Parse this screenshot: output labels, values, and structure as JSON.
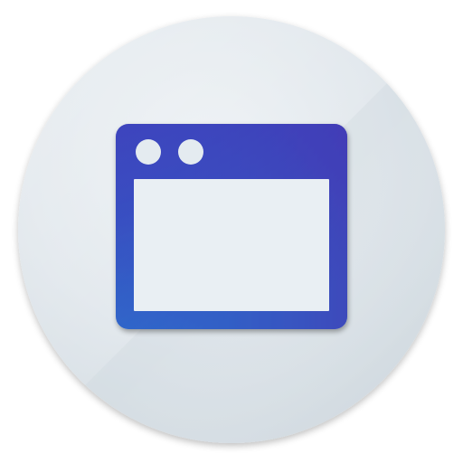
{
  "icon": {
    "name": "browser-window-icon",
    "colors": {
      "page_background": "#ffffff",
      "circle_fill_light": "#e9eef2",
      "circle_fill_mid": "#dde4ea",
      "circle_fill_dark": "#cfd8df",
      "window_gradient_start": "#3b3fb8",
      "window_gradient_end": "#4b2fb0",
      "window_frame_bottom": "#2f63c8",
      "window_content": "#eaf0f4",
      "dot_fill": "#e6edf2",
      "shadow": "#8a9aa8"
    }
  }
}
